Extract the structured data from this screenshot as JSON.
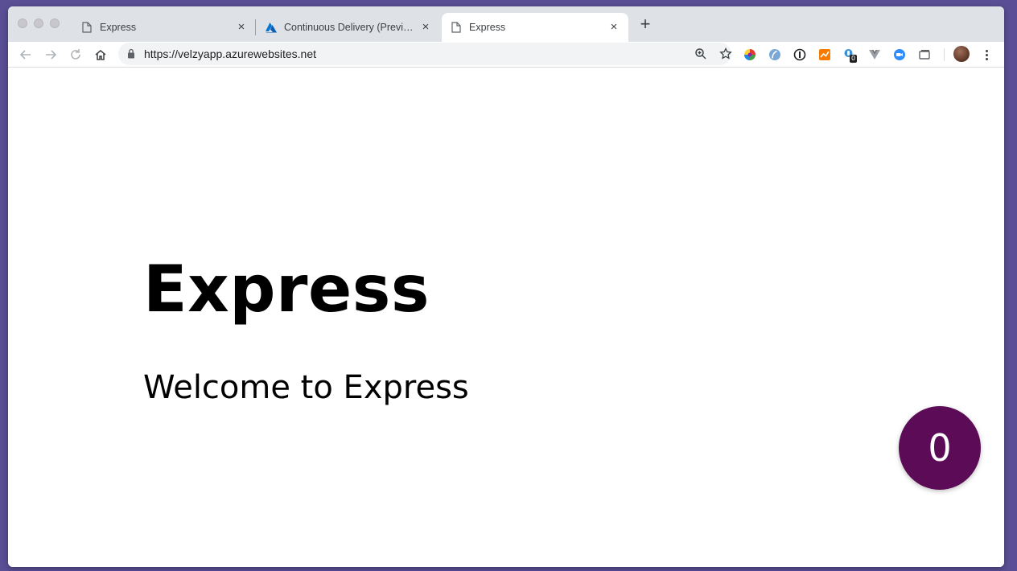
{
  "browser": {
    "tabs": [
      {
        "title": "Express",
        "icon": "document-icon",
        "active": false
      },
      {
        "title": "Continuous Delivery (Preview)",
        "icon": "azure-icon",
        "active": false
      },
      {
        "title": "Express",
        "icon": "document-icon",
        "active": true
      }
    ],
    "close_glyph": "×",
    "new_tab_glyph": "+",
    "url": "https://velzyapp.azurewebsites.net",
    "extension_badge": "0"
  },
  "page": {
    "heading": "Express",
    "subheading": "Welcome to Express",
    "counter": "0"
  },
  "colors": {
    "counter_bg": "#5c0b57",
    "desktop_bg": "#5a4f96",
    "azure_blue": "#0078d4"
  }
}
